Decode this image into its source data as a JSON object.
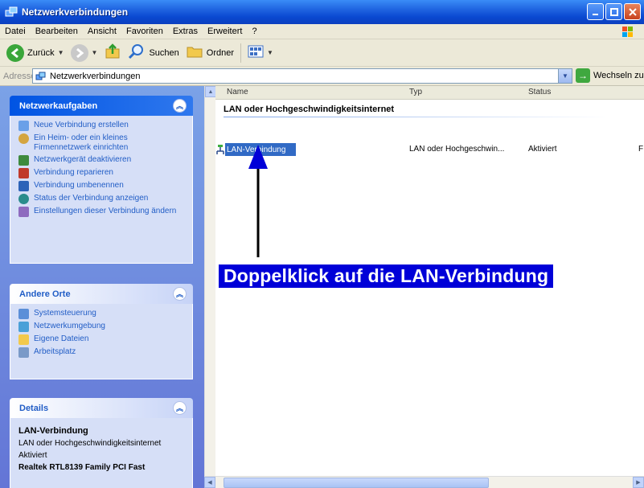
{
  "window": {
    "title": "Netzwerkverbindungen"
  },
  "menu": [
    "Datei",
    "Bearbeiten",
    "Ansicht",
    "Favoriten",
    "Extras",
    "Erweitert",
    "?"
  ],
  "toolbar": {
    "back": "Zurück",
    "search": "Suchen",
    "folders": "Ordner"
  },
  "address": {
    "label": "Adresse",
    "value": "Netzwerkverbindungen",
    "go": "Wechseln zu"
  },
  "taskpane": {
    "network_tasks": {
      "title": "Netzwerkaufgaben",
      "items": [
        "Neue Verbindung erstellen",
        "Ein Heim- oder ein kleines Firmennetzwerk einrichten",
        "Netzwerkgerät deaktivieren",
        "Verbindung reparieren",
        "Verbindung umbenennen",
        "Status der Verbindung anzeigen",
        "Einstellungen dieser Verbindung ändern"
      ]
    },
    "other_places": {
      "title": "Andere Orte",
      "items": [
        "Systemsteuerung",
        "Netzwerkumgebung",
        "Eigene Dateien",
        "Arbeitsplatz"
      ]
    },
    "details": {
      "title": "Details",
      "name": "LAN-Verbindung",
      "type": "LAN oder Hochgeschwindigkeitsinternet",
      "status": "Aktiviert",
      "device": "Realtek RTL8139 Family PCI Fast"
    }
  },
  "list": {
    "columns": {
      "name": "Name",
      "type": "Typ",
      "status": "Status"
    },
    "group": "LAN oder Hochgeschwindigkeitsinternet",
    "rows": [
      {
        "name": "LAN-Verbindung",
        "type": "LAN oder Hochgeschwin...",
        "status": "Aktiviert",
        "extra": "F"
      }
    ]
  },
  "annotation": {
    "text": "Doppelklick auf die LAN-Verbindung"
  },
  "colors": {
    "titlebar": "#0a49d1",
    "taskpane": "#6375d6",
    "callout": "#0000d8",
    "selection": "#316ac5"
  }
}
